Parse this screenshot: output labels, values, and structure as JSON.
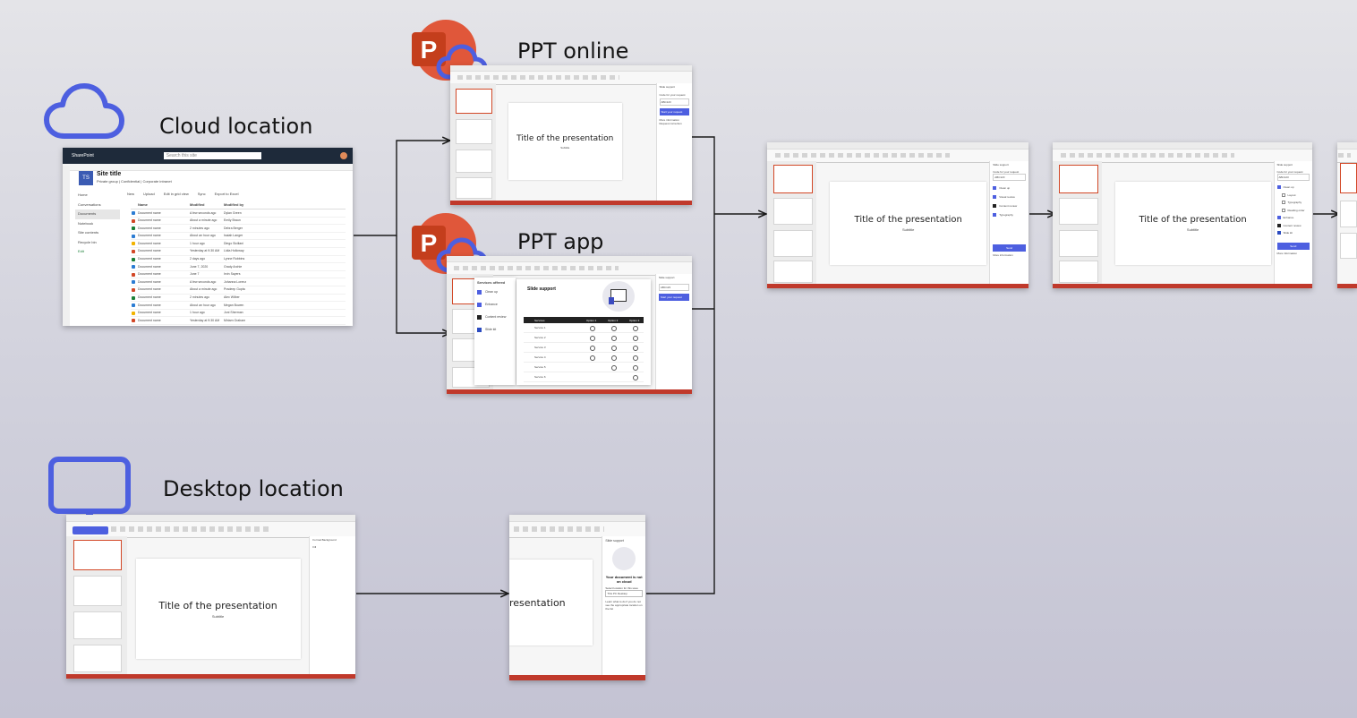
{
  "labels": {
    "cloud_location": "Cloud location",
    "ppt_online": "PPT online",
    "ppt_app": "PPT app",
    "desktop_location": "Desktop location"
  },
  "icons": {
    "cloud": "cloud-icon",
    "monitor": "monitor-icon",
    "powerpoint": "powerpoint-icon"
  },
  "colors": {
    "accent_blue": "#4d5fe0",
    "powerpoint_orange": "#d24726",
    "arrow": "#1a1a1a"
  },
  "slide": {
    "title": "Title of the presentation",
    "subtitle": "Subtitle",
    "partial_title": "resentation"
  },
  "sharepoint": {
    "app_name": "SharePoint",
    "search_placeholder": "Search this site",
    "site_title": "Site title",
    "site_initials": "TS",
    "site_meta": "Private group | Confidential | Corporate intranet",
    "nav": [
      "Home",
      "Conversations",
      "Documents",
      "Notebook",
      "Site contents",
      "Recycle bin",
      "Edit"
    ],
    "toolbar": [
      "New",
      "Upload",
      "Edit in grid view",
      "Sync",
      "Export to Excel"
    ],
    "columns": [
      "Name",
      "Modified",
      "Modified by"
    ],
    "rows": [
      [
        "Document name",
        "A few seconds ago",
        "Dylan Green"
      ],
      [
        "Document name",
        "About a minute ago",
        "Emily Braun"
      ],
      [
        "Document name",
        "2 minutes ago",
        "Debra Berger"
      ],
      [
        "Document name",
        "About an hour ago",
        "Isaiah Langer"
      ],
      [
        "Document name",
        "1 hour ago",
        "Diego Siciliani"
      ],
      [
        "Document name",
        "Yesterday at 9:30 AM",
        "Lidia Holloway"
      ],
      [
        "Document name",
        "2 days ago",
        "Lynne Robbins"
      ],
      [
        "Document name",
        "June 7, 2020",
        "Grady Archie"
      ],
      [
        "Document name",
        "June 7",
        "Irvin Sayers"
      ],
      [
        "Document name",
        "A few seconds ago",
        "Johanna Lorenz"
      ],
      [
        "Document name",
        "About a minute ago",
        "Pradeep Gupta"
      ],
      [
        "Document name",
        "2 minutes ago",
        "Alex Wilber"
      ],
      [
        "Document name",
        "About an hour ago",
        "Megan Bowen"
      ],
      [
        "Document name",
        "1 hour ago",
        "Joni Sherman"
      ],
      [
        "Document name",
        "Yesterday at 9:30 AM",
        "Miriam Graham"
      ]
    ]
  },
  "ppt_online_pane": {
    "header": "Slide support",
    "code_label": "Code for your request",
    "code_value": "ABC123",
    "button": "Start your request",
    "more": "More information",
    "request": "Request correction"
  },
  "ppt_app_pane": {
    "menu_header": "Services offered",
    "menu_items": [
      "Clean up",
      "Enhance",
      "Content review",
      "Slide kit"
    ],
    "dialog_title": "Slide support",
    "table_headers": [
      "Services",
      "Option 1",
      "Option 2",
      "Option 3"
    ],
    "table_rows": [
      "Service 1",
      "Service 2",
      "Service 3",
      "Service 4",
      "Service 5",
      "Service 6"
    ]
  },
  "step2_pane": {
    "header": "Slide support",
    "code_label": "Code for your request",
    "code_value": "ABC123",
    "options": [
      "Clean up",
      "Visual review",
      "Content review",
      "Typography"
    ],
    "button": "Send",
    "more": "More information"
  },
  "step3_pane": {
    "header": "Slide support",
    "code_label": "Code for your request",
    "code_value": "ABC123",
    "options": [
      "Clean up",
      "Layout",
      "Typography",
      "Reading order",
      "Enhance",
      "Content review",
      "Slide kit"
    ],
    "button": "Send",
    "more": "More information"
  },
  "not_cloud_pane": {
    "header": "Slide support",
    "message": "Your document is not on cloud",
    "select_label": "Select location for this save",
    "select_value": "This PC Desktop",
    "note": "Learn what to do if you do not see the appropriate location on the list",
    "button": "Save"
  },
  "desktop_pane": {
    "header": "Format Background",
    "fill": "Fill"
  }
}
